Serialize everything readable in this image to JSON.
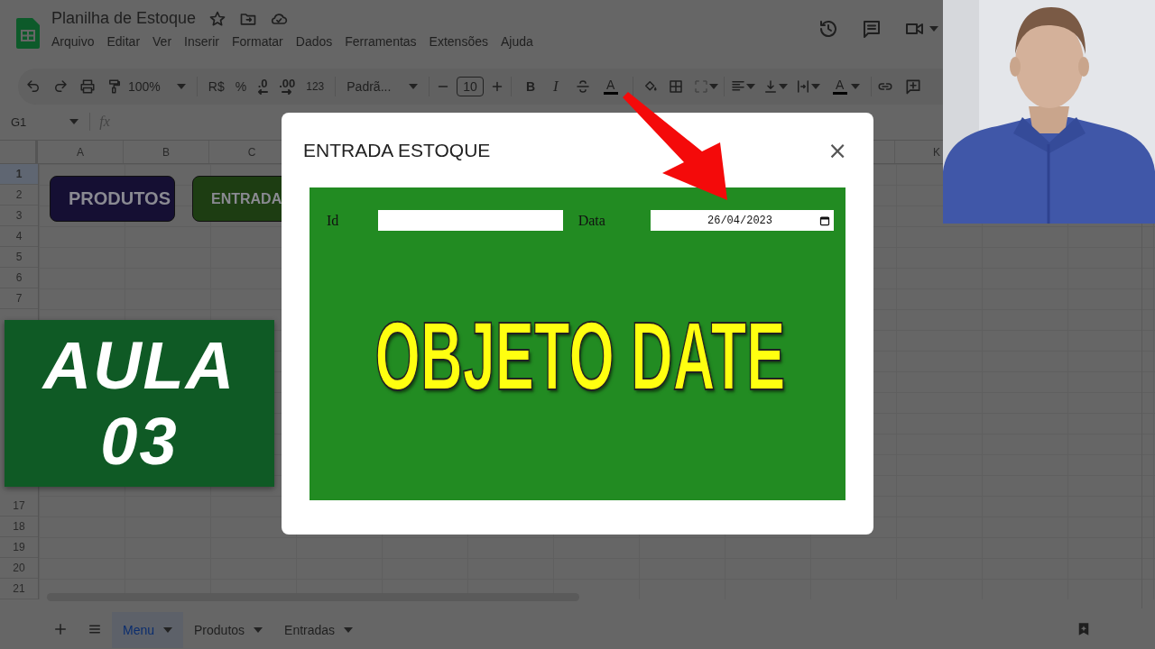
{
  "header": {
    "title": "Planilha de Estoque",
    "menu": [
      "Arquivo",
      "Editar",
      "Ver",
      "Inserir",
      "Formatar",
      "Dados",
      "Ferramentas",
      "Extensões",
      "Ajuda"
    ]
  },
  "toolbar": {
    "zoom": "100%",
    "currency": "R$",
    "percent": "%",
    "decrease_decimals": ".0",
    "increase_decimals": ".00",
    "number_format": "123",
    "font": "Padrã...",
    "font_size": "10",
    "bold": "B",
    "italic": "I",
    "text_color": "A",
    "text_rotation": "A"
  },
  "formula_bar": {
    "cell_ref": "G1",
    "function_label": "fx"
  },
  "sheet": {
    "columns_left": [
      "A",
      "B",
      "C"
    ],
    "columns_right": [
      "K"
    ],
    "rows_top": [
      {
        "label": "1",
        "selected": true
      },
      {
        "label": "2",
        "selected": false
      },
      {
        "label": "3",
        "selected": false
      },
      {
        "label": "4",
        "selected": false
      },
      {
        "label": "5",
        "selected": false
      },
      {
        "label": "6",
        "selected": false
      },
      {
        "label": "7",
        "selected": false
      }
    ],
    "rows_bottom": [
      {
        "label": "17",
        "selected": false
      },
      {
        "label": "18",
        "selected": false
      },
      {
        "label": "19",
        "selected": false
      },
      {
        "label": "20",
        "selected": false
      },
      {
        "label": "21",
        "selected": false
      }
    ],
    "buttons": [
      {
        "label": "PRODUTOS",
        "color": "#150f33"
      },
      {
        "label": "ENTRADA",
        "color": "#1d3d12"
      }
    ]
  },
  "sheet_tabs": [
    {
      "label": "Menu",
      "selected": true
    },
    {
      "label": "Produtos",
      "selected": false
    },
    {
      "label": "Entradas",
      "selected": false
    }
  ],
  "lesson_badge": {
    "title": "AULA",
    "number": "03"
  },
  "dialog": {
    "title": "ENTRADA ESTOQUE",
    "close": "×",
    "fields": [
      {
        "kind": "text",
        "label": "Id"
      },
      {
        "kind": "date",
        "label": "Data",
        "value": "26/04/2023"
      }
    ],
    "headline": "OBJETO DATE"
  }
}
